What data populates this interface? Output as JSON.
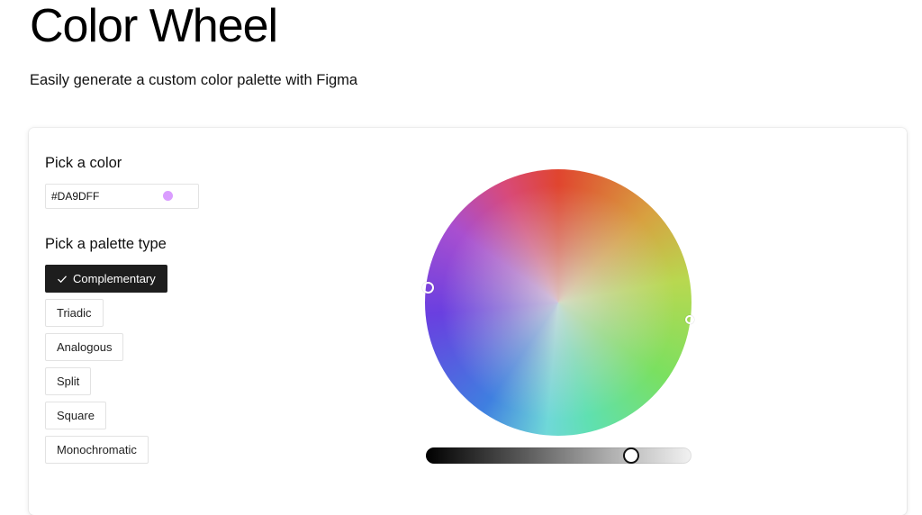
{
  "header": {
    "title": "Color Wheel",
    "subtitle": "Easily generate a custom color palette with Figma"
  },
  "picker": {
    "label": "Pick a color",
    "hex_value": "#DA9DFF",
    "swatch_color": "#DA9DFF"
  },
  "palette": {
    "label": "Pick a palette type",
    "selected": "Complementary",
    "selected_icon": "check-icon",
    "options": [
      "Complementary",
      "Triadic",
      "Analogous",
      "Split",
      "Square",
      "Monochromatic"
    ]
  },
  "wheel": {
    "handles": [
      "hue-handle-primary",
      "hue-handle-complement"
    ]
  },
  "lightness": {
    "value": 0.79
  }
}
